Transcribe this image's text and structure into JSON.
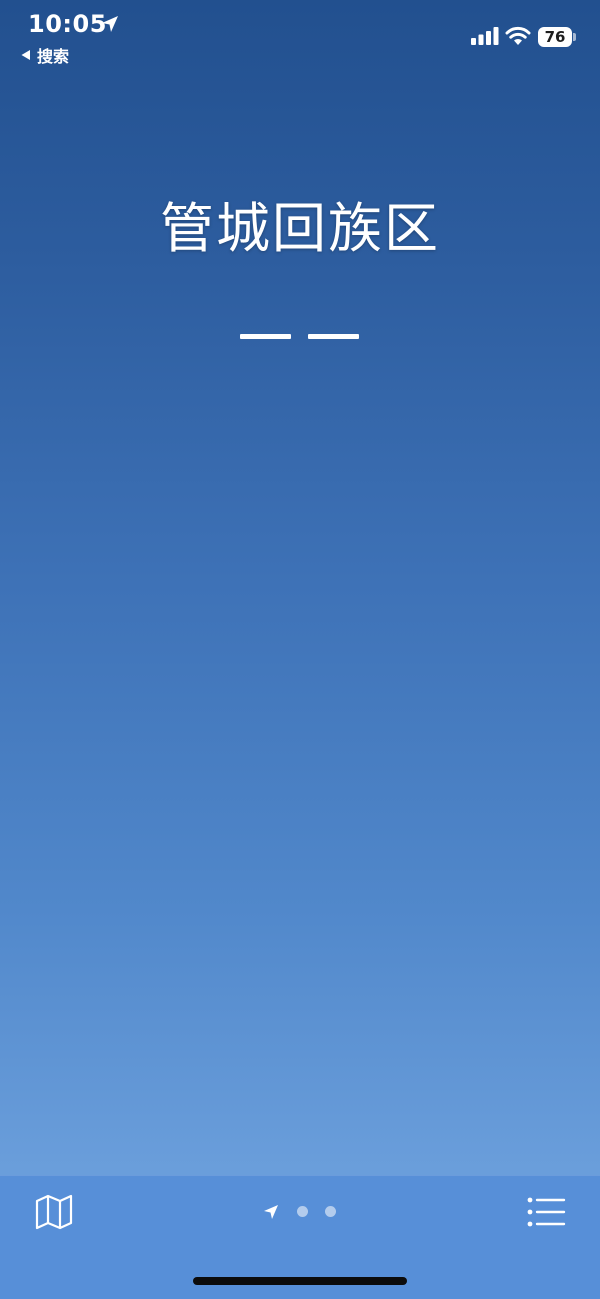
{
  "status_bar": {
    "time": "10:05",
    "battery_level": "76",
    "back_label": "搜索"
  },
  "weather": {
    "location": "管城回族区",
    "temperature_placeholder": "— —"
  },
  "toolbar": {
    "map_icon": "map-icon",
    "list_icon": "list-icon",
    "page_indicator": {
      "current_page_icon": "location-arrow-icon",
      "page_count": 3,
      "current_index": 0
    }
  },
  "colors": {
    "background_top": "#22508f",
    "background_bottom": "#6ea2de",
    "toolbar": "#548cd7",
    "text": "#ffffff"
  }
}
